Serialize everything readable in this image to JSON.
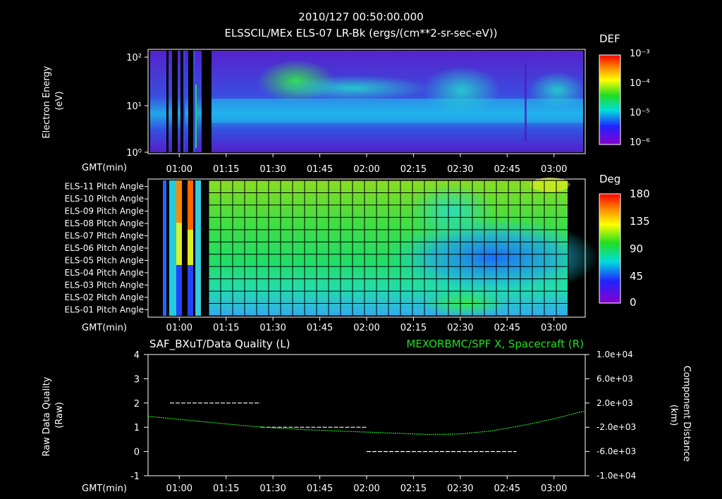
{
  "header": {
    "timestamp": "2010/127 00:50:00.000",
    "title": "ELSSCIL/MEx ELS-07 LR-Bk  (ergs/(cm**2-sr-sec-eV))"
  },
  "chart_data": [
    {
      "type": "heatmap",
      "ylabel": "Electron Energy (eV)",
      "yscale": "log",
      "ylim": [
        1,
        200
      ],
      "yticks": [
        "10⁰",
        "10¹",
        "10²"
      ],
      "xlabel": "GMT(min)",
      "xticks": [
        "01:00",
        "01:15",
        "01:30",
        "01:45",
        "02:00",
        "02:15",
        "02:30",
        "02:45",
        "03:00"
      ],
      "xlim_minutes_gmt": [
        50,
        190
      ],
      "colorbar": {
        "title": "DEF",
        "labels": [
          "10⁻³",
          "10⁻⁴",
          "10⁻⁵",
          "10⁻⁶"
        ],
        "range": [
          1e-06,
          0.001
        ],
        "scale": "log"
      }
    },
    {
      "type": "heatmap",
      "rows": [
        "ELS-11 Pitch Angle",
        "ELS-10 Pitch Angle",
        "ELS-09 Pitch Angle",
        "ELS-08 Pitch Angle",
        "ELS-07 Pitch Angle",
        "ELS-06 Pitch Angle",
        "ELS-05 Pitch Angle",
        "ELS-04 Pitch Angle",
        "ELS-03 Pitch Angle",
        "ELS-02 Pitch Angle",
        "ELS-01 Pitch Angle"
      ],
      "xlabel": "GMT(min)",
      "xticks": [
        "01:00",
        "01:15",
        "01:30",
        "01:45",
        "02:00",
        "02:15",
        "02:30",
        "02:45",
        "03:00"
      ],
      "colorbar": {
        "title": "Deg",
        "labels": [
          "180",
          "135",
          "90",
          "45",
          "0"
        ],
        "range": [
          0,
          180
        ]
      }
    },
    {
      "type": "line",
      "left_title": "SAF_BXuT/Data Quality (L)",
      "right_title": "MEXORBMC/SPF X, Spacecraft (R)",
      "ylabel_left": "Raw Data Quality (Raw)",
      "ylabel_right": "Component Distance (km)",
      "xlabel": "GMT(min)",
      "xticks": [
        "01:00",
        "01:15",
        "01:30",
        "01:45",
        "02:00",
        "02:15",
        "02:30",
        "02:45",
        "03:00"
      ],
      "yticks_left": [
        "4",
        "3",
        "2",
        "1",
        "0",
        "-1"
      ],
      "ylim_left": [
        -1,
        4
      ],
      "yticks_right": [
        "1.0e+04",
        "6.0e+03",
        "2.0e+03",
        "-2.0e+03",
        "-6.0e+03",
        "-1.0e+04"
      ],
      "ylim_right": [
        -10000,
        10000
      ],
      "series": [
        {
          "name": "SAF_BXuT/Data Quality (L)",
          "axis": "left",
          "color": "#ffffff",
          "segments": [
            {
              "x": [
                57,
                86
              ],
              "y": 2
            },
            {
              "x": [
                86,
                120
              ],
              "y": 1
            },
            {
              "x": [
                120,
                168
              ],
              "y": 0
            }
          ]
        },
        {
          "name": "MEXORBMC/SPF X, Spacecraft (R)",
          "axis": "right",
          "color": "#22dd22",
          "x": [
            50,
            60,
            70,
            80,
            90,
            100,
            110,
            120,
            130,
            140,
            150,
            160,
            170,
            180,
            190
          ],
          "y": [
            -200,
            -700,
            -1200,
            -1700,
            -2100,
            -2400,
            -2600,
            -2800,
            -3000,
            -3200,
            -3100,
            -2600,
            -1700,
            -600,
            700
          ]
        }
      ]
    }
  ]
}
